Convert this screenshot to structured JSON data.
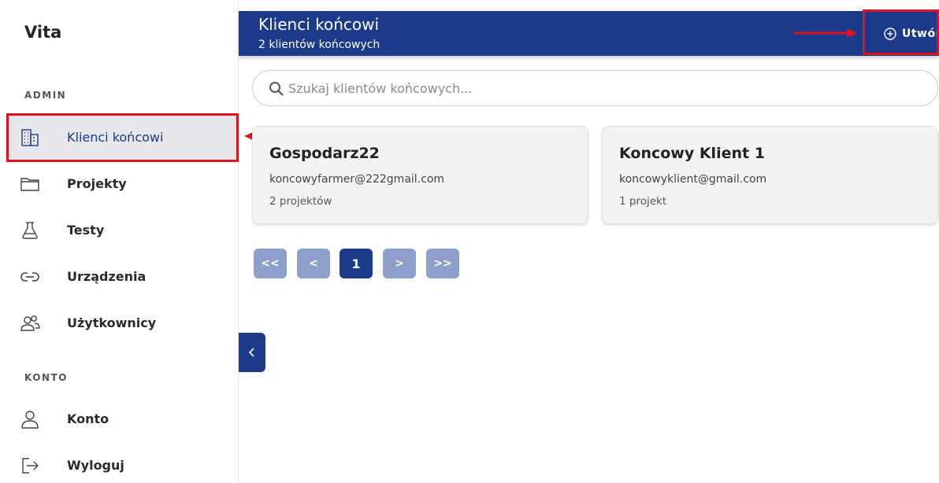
{
  "app": {
    "brand": "Vita"
  },
  "sidebar": {
    "sections": [
      {
        "label": "ADMIN",
        "items": [
          {
            "label": "Klienci końcowi",
            "icon": "building-icon",
            "active": true
          },
          {
            "label": "Projekty",
            "icon": "folder-icon"
          },
          {
            "label": "Testy",
            "icon": "flask-icon"
          },
          {
            "label": "Urządzenia",
            "icon": "link-icon"
          },
          {
            "label": "Użytkownicy",
            "icon": "users-icon"
          }
        ]
      },
      {
        "label": "KONTO",
        "items": [
          {
            "label": "Konto",
            "icon": "user-icon"
          },
          {
            "label": "Wyloguj",
            "icon": "logout-icon"
          }
        ]
      }
    ]
  },
  "header": {
    "title": "Klienci końcowi",
    "subtitle": "2 klientów końcowych",
    "create_label": "Utwórz",
    "create_icon": "plus-circle-icon"
  },
  "search": {
    "placeholder": "Szukaj klientów końcowych...",
    "value": ""
  },
  "clients": [
    {
      "name": "Gospodarz22",
      "email": "koncowyfarmer@222gmail.com",
      "projects": "2 projektów"
    },
    {
      "name": "Koncowy Klient 1",
      "email": "koncowyklient@gmail.com",
      "projects": "1 projekt"
    }
  ],
  "pagination": {
    "first": "<<",
    "prev": "<",
    "current": "1",
    "next": ">",
    "last": ">>"
  },
  "colors": {
    "primary": "#1b3a8c",
    "pagination_inactive": "#8f9fcc",
    "annotation_red": "#e0121b"
  }
}
